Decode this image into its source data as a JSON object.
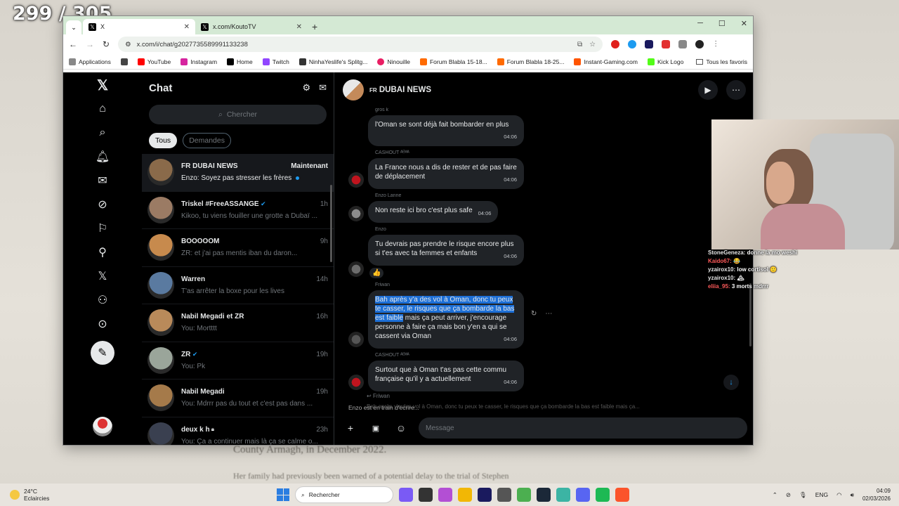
{
  "overlay": {
    "counter": "299 / 305"
  },
  "background_doc": {
    "line1": "County Armagh, in December 2022.",
    "line2": "Her family had previously been warned of a potential delay to the trial of Stephen"
  },
  "browser": {
    "tabs": [
      {
        "title": "X",
        "active": true
      },
      {
        "title": "x.com/KoutoTV",
        "active": false
      }
    ],
    "new_tab": "+",
    "url": "x.com/i/chat/g2027735589991133238",
    "bookmarks": [
      {
        "label": "Applications",
        "color": "#888"
      },
      {
        "label": "YouTube",
        "color": "#ff0000"
      },
      {
        "label": "Instagram",
        "color": "#d6249f"
      },
      {
        "label": "Home",
        "color": "#000000"
      },
      {
        "label": "Twitch",
        "color": "#9146ff"
      },
      {
        "label": "NinhaYeslife's Splitg...",
        "color": "#333333"
      },
      {
        "label": "Ninouille",
        "color": "#e91e63"
      },
      {
        "label": "Forum Blabla 15-18...",
        "color": "#ff6a00"
      },
      {
        "label": "Forum Blabla 18-25...",
        "color": "#ff6a00"
      },
      {
        "label": "Instant-Gaming.com",
        "color": "#ff5400"
      },
      {
        "label": "Kick Logo",
        "color": "#53fc18"
      }
    ],
    "all_bookmarks": "Tous les favoris"
  },
  "chat_list": {
    "title": "Chat",
    "search_placeholder": "Chercher",
    "filters": [
      "Tous",
      "Demandes"
    ],
    "conversations": [
      {
        "name": "FR DUBAI NEWS",
        "time": "Maintenant",
        "preview": "Enzo: Soyez pas stresser les frères",
        "selected": true,
        "color": "#8a6a4a"
      },
      {
        "name": "Triskel #FreeASSANGE",
        "time": "1h",
        "preview": "Kikoo, tu viens fouiller une grotte a Dubaï ...",
        "verified": true,
        "color": "#9b7b64"
      },
      {
        "name": "BOOOOOM",
        "time": "9h",
        "preview": "ZR: et j'ai pas mentis iban du daron...",
        "color": "#c78a4d"
      },
      {
        "name": "Warren",
        "time": "14h",
        "preview": "T'as arrêter la boxe pour les lives",
        "color": "#5a7aa0"
      },
      {
        "name": "Nabil Megadi et ZR",
        "time": "16h",
        "preview": "You: Mortttt",
        "color": "#b98a5a"
      },
      {
        "name": "ZR",
        "time": "19h",
        "preview": "You: Pk",
        "verified": true,
        "color": "#9aa59a"
      },
      {
        "name": "Nabil Megadi",
        "time": "19h",
        "preview": "You: Mdrrr pas du tout et c'est pas dans ...",
        "color": "#a57a4a"
      },
      {
        "name": "deux k h",
        "time": "23h",
        "preview": "You: Ça a continuer mais là ça se calme o...",
        "locked": true,
        "color": "#3a4050"
      }
    ]
  },
  "conversation": {
    "title": "DUBAI NEWS",
    "flag": "FR",
    "messages": [
      {
        "sender": "gros k",
        "text": "l'Oman se sont déjà fait bombarder en plus",
        "time": "04:06",
        "avatar": false
      },
      {
        "sender": "CASHOUT ᴬᴱᴹᴬ",
        "text": "La France nous a dis de rester et de pas faire de déplacement",
        "time": "04:06",
        "avatar": true,
        "avcolor": "#c0141e"
      },
      {
        "sender": "Enzo Lanne",
        "text": "Non reste ici bro c'est plus safe",
        "time": "04:06",
        "avatar": true,
        "avcolor": "#8c8c8c"
      },
      {
        "sender": "Enzo",
        "text": "Tu devrais pas prendre le risque encore plus si t'es avec ta femmes et enfants",
        "time": "04:06",
        "avatar": true,
        "avcolor": "#6c6c6c",
        "reaction": "👍"
      },
      {
        "sender": "Friwan",
        "text_hl": "Bah après y'a des vol à Oman, donc tu peux te casser, le risques que ça bombarde la bas est faible",
        "text": " mais ça peut arriver, j'encourage personne à faire ça mais bon y'en a qui se cassent via Oman",
        "time": "04:06",
        "avatar": true,
        "avcolor": "#555555"
      },
      {
        "sender": "CASHOUT ᴬᴱᴹᴬ",
        "text": "Surtout que à Oman t'as pas cette commu française qu'il y a actuellement",
        "time": "04:06",
        "avatar": true,
        "avcolor": "#c0141e"
      }
    ],
    "reply_to": "Friwan",
    "reply_preview": "Bah après y'a des vol à Oman, donc tu peux te casser, le risques que ça bombarde la bas est faible mais ça...",
    "typing": "Enzo est en train d'écrire...",
    "composer_placeholder": "Message"
  },
  "stream_chat": [
    {
      "user": "StoneGeneza:",
      "text": "donne la mo weshi"
    },
    {
      "user": "Kaido67:",
      "text": "😂"
    },
    {
      "user": "yzairox10:",
      "text": "low cortisol 🙂"
    },
    {
      "user": "yzairox10:",
      "text": "🏔"
    },
    {
      "user": "eliia_95:",
      "text": "3 morts mdrrr"
    }
  ],
  "taskbar": {
    "temp": "24°C",
    "weather": "Eclaircies",
    "search": "Rechercher",
    "lang": "ENG",
    "time": "04:09",
    "date": "02/03/2026",
    "apps": [
      "#7a5af5",
      "#333",
      "#b34fd4",
      "#f2b705",
      "#1a1a5e",
      "#555",
      "#4caf50",
      "#1b2838",
      "#3cb4a4",
      "#5865f2",
      "#1db954",
      "#fb542b"
    ]
  }
}
